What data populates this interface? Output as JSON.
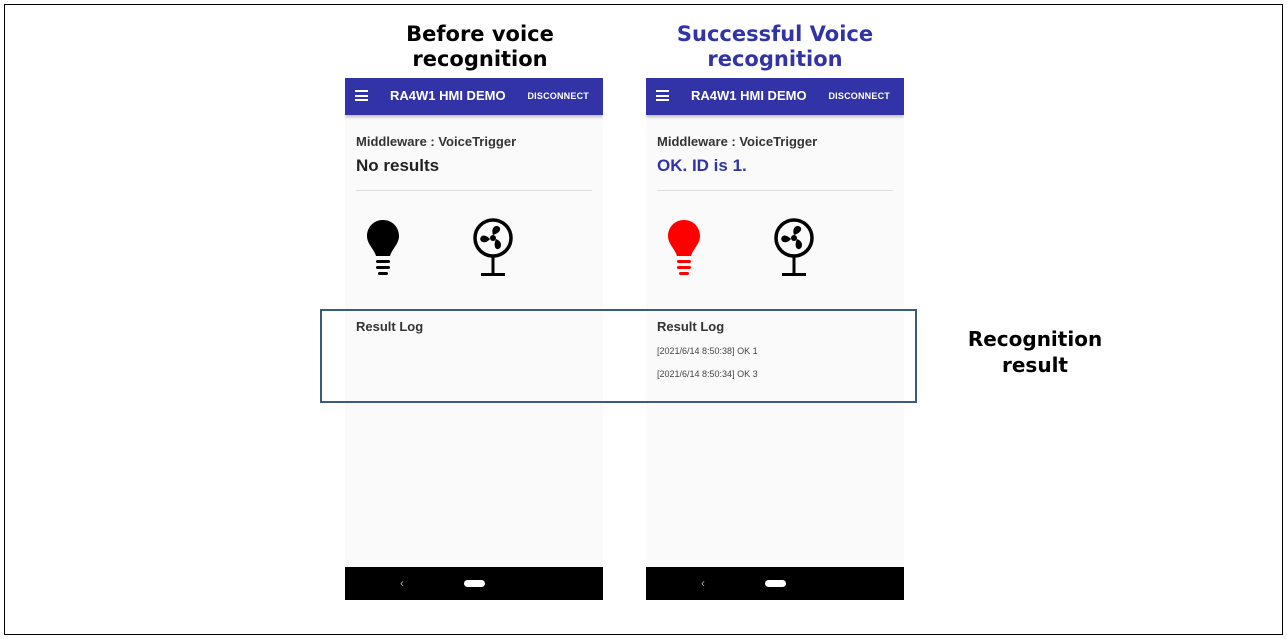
{
  "captions": {
    "before": "Before voice recognition",
    "after": "Successful Voice recognition",
    "recognition_result": "Recognition result"
  },
  "phones": [
    {
      "app_title": "RA4W1 HMI DEMO",
      "disconnect_label": "DISCONNECT",
      "middleware_label": "Middleware : VoiceTrigger",
      "status_text": "No results",
      "bulb_color": "#000000",
      "log_label": "Result Log",
      "log_entries": []
    },
    {
      "app_title": "RA4W1 HMI DEMO",
      "disconnect_label": "DISCONNECT",
      "middleware_label": "Middleware : VoiceTrigger",
      "status_text": "OK. ID is 1.",
      "bulb_color": "#ff0000",
      "log_label": "Result Log",
      "log_entries": [
        "[2021/6/14 8:50:38] OK 1",
        "[2021/6/14 8:50:34] OK 3"
      ]
    }
  ],
  "colors": {
    "appbar": "#3133a6",
    "accent_text": "#3133a6",
    "highlight_border": "#3c5a80"
  },
  "icons": {
    "menu": "hamburger-menu-icon",
    "light": "lightbulb-icon",
    "fan": "fan-icon",
    "back": "back-icon",
    "home": "home-pill-icon"
  }
}
